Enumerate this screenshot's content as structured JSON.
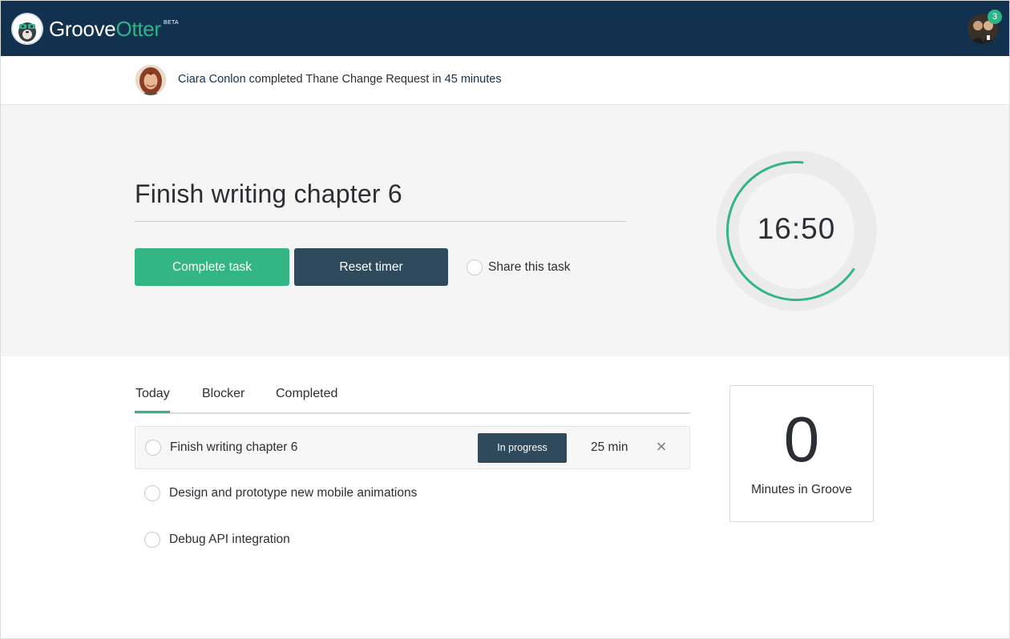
{
  "header": {
    "brand_groove": "Groove",
    "brand_otter": "Otter",
    "beta_label": "BETA",
    "notification_count": "3",
    "colors": {
      "bar": "#12314f",
      "accent": "#2fb487"
    },
    "icons": {
      "logo": "otter-logo-icon",
      "user": "user-avatar"
    }
  },
  "activity": {
    "user_name": "Ciara Conlon",
    "action_text": " completed Thane Change Request in ",
    "duration": "45 minutes"
  },
  "current_task": {
    "title": "Finish writing chapter 6",
    "complete_button": "Complete task",
    "reset_button": "Reset timer",
    "share_label": "Share this task",
    "timer_display": "16:50",
    "timer_progress": 0.67
  },
  "tabs": {
    "items": [
      {
        "label": "Today",
        "active": true
      },
      {
        "label": "Blocker",
        "active": false
      },
      {
        "label": "Completed",
        "active": false
      }
    ]
  },
  "tasks": [
    {
      "name": "Finish writing chapter 6",
      "status": "In progress",
      "duration": "25 min",
      "remove_icon": "×"
    },
    {
      "name": "Design and prototype new mobile animations"
    },
    {
      "name": "Debug API integration"
    }
  ],
  "stats": {
    "value": "0",
    "label": "Minutes in Groove"
  }
}
